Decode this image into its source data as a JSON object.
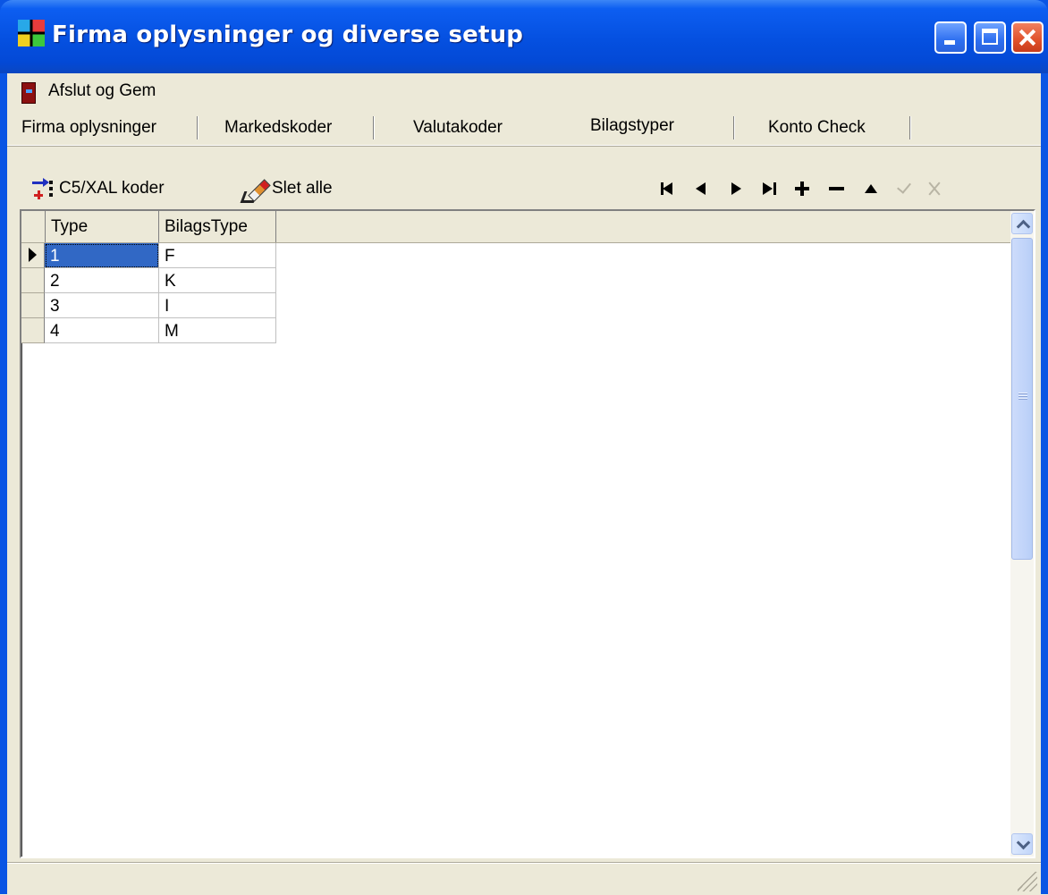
{
  "window": {
    "title": "Firma oplysninger og diverse setup",
    "app_icon": "app-icon",
    "controls": [
      "minimize",
      "maximize",
      "close"
    ]
  },
  "menu": {
    "exit_save_label": "Afslut og Gem",
    "exit_save_icon": "door-icon"
  },
  "tabs": [
    {
      "label": "Firma oplysninger",
      "active": false
    },
    {
      "label": "Markedskoder",
      "active": false
    },
    {
      "label": "Valutakoder",
      "active": false
    },
    {
      "label": "Bilagstyper",
      "active": true
    },
    {
      "label": "Konto Check",
      "active": false
    }
  ],
  "toolbar": {
    "c5_label": "C5/XAL koder",
    "delete_all_label": "Slet alle",
    "navigator": [
      "first",
      "prior",
      "next",
      "last",
      "insert",
      "delete",
      "edit",
      "post",
      "cancel"
    ]
  },
  "grid": {
    "columns": [
      "Type",
      "BilagsType"
    ],
    "rows": [
      {
        "type": "1",
        "bilagstype": "F",
        "current": true
      },
      {
        "type": "2",
        "bilagstype": "K",
        "current": false
      },
      {
        "type": "3",
        "bilagstype": "I",
        "current": false
      },
      {
        "type": "4",
        "bilagstype": "M",
        "current": false
      }
    ]
  },
  "colors": {
    "titlebar": "#0550e0",
    "selection": "#3168c5",
    "face": "#ece9d8",
    "close_button": "#e0502a"
  }
}
